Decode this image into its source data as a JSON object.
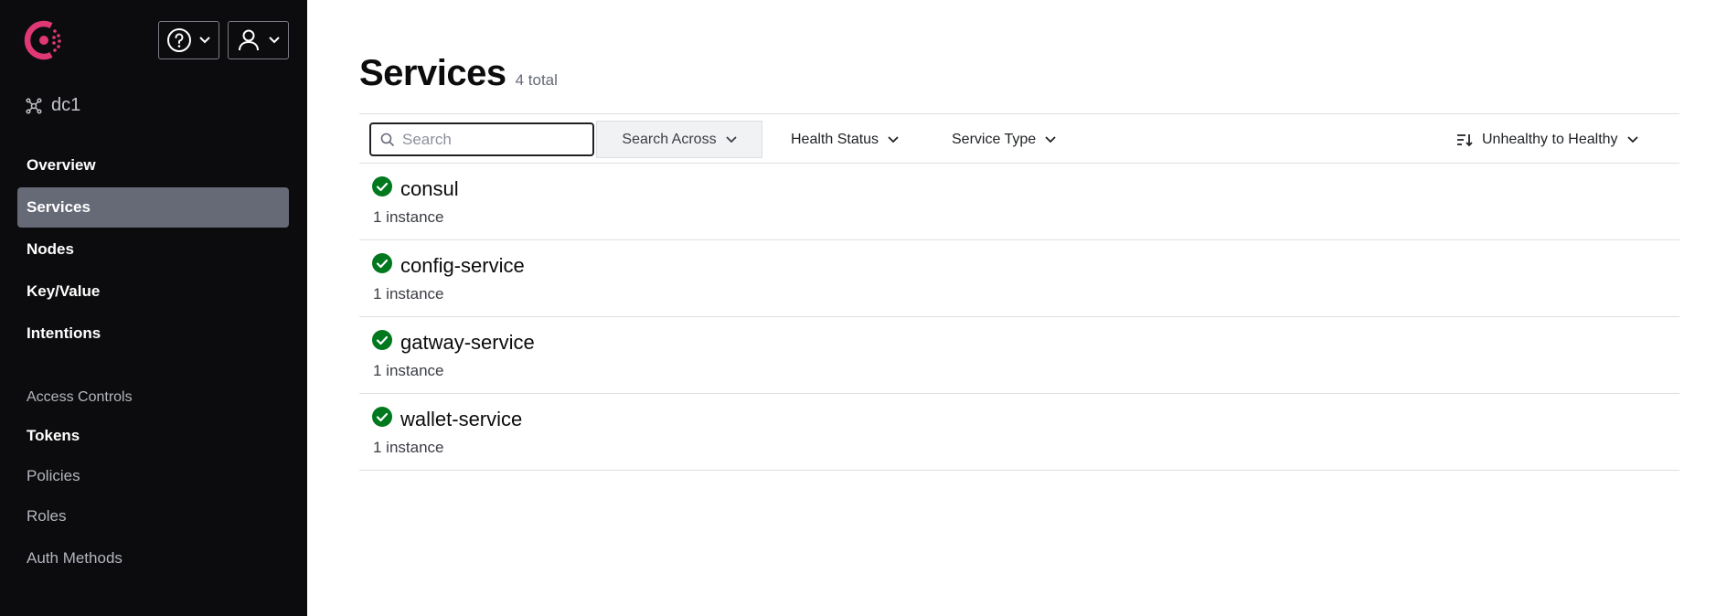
{
  "sidebar": {
    "datacenter": "dc1",
    "nav": [
      {
        "label": "Overview",
        "active": false
      },
      {
        "label": "Services",
        "active": true
      },
      {
        "label": "Nodes",
        "active": false
      },
      {
        "label": "Key/Value",
        "active": false
      },
      {
        "label": "Intentions",
        "active": false
      }
    ],
    "access_heading": "Access Controls",
    "access": [
      {
        "label": "Tokens"
      },
      {
        "label": "Policies"
      },
      {
        "label": "Roles"
      },
      {
        "label": "Auth Methods"
      }
    ]
  },
  "header": {
    "help_icon": "help-circle-icon",
    "user_icon": "user-icon"
  },
  "main": {
    "title": "Services",
    "total": "4 total",
    "search_placeholder": "Search",
    "search_across": "Search Across",
    "health_status": "Health Status",
    "service_type": "Service Type",
    "sort": "Unhealthy to Healthy",
    "services": [
      {
        "name": "consul",
        "instances": "1 instance",
        "status": "passing"
      },
      {
        "name": "config-service",
        "instances": "1 instance",
        "status": "passing"
      },
      {
        "name": "gatway-service",
        "instances": "1 instance",
        "status": "passing"
      },
      {
        "name": "wallet-service",
        "instances": "1 instance",
        "status": "passing"
      }
    ]
  },
  "colors": {
    "brand": "#e03875",
    "sidebar_bg": "#0c0c0e",
    "active_nav": "#656a76",
    "passing": "#00781e"
  }
}
